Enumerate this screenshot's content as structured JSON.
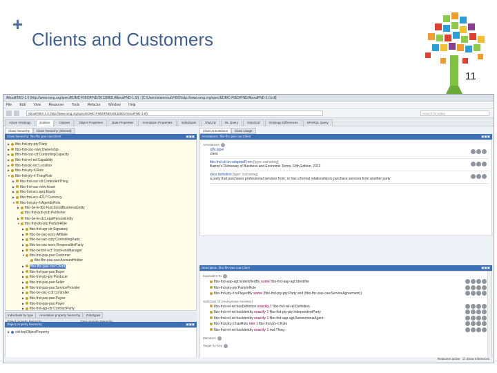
{
  "slide": {
    "plus": "+",
    "title": "Clients and Customers",
    "page_number": "11"
  },
  "app": {
    "window_title": "AboutFIBO-1.0 (http://www.omg.org/spec/EDMC-FIBO/FND/20130801/AboutFND-1.0/) : [C:\\Users\\elanemut\\FIBO\\http://www.omg.org/spec/EDMC-FIBO/FND/AboutFND-1.0.rdf]",
    "menu": [
      "File",
      "Edit",
      "View",
      "Reasoner",
      "Tools",
      "Refactor",
      "Window",
      "Help"
    ],
    "address": "AboutFIBO-1.0 (http://www.omg.org/spec/EDMC-FIBO/FND/20130801/AboutFND-1.0/)",
    "search_placeholder": "Search for entity",
    "tabs": [
      "Active Ontology",
      "Entities",
      "Classes",
      "Object Properties",
      "Data Properties",
      "Annotation Properties",
      "Individuals",
      "OWLViz",
      "DL Query",
      "OntoGraf",
      "Ontology Differences",
      "SPARQL Query"
    ],
    "active_tab": "Entities"
  },
  "left_panel": {
    "subtabs": [
      "Class hierarchy",
      "Class hierarchy (inferred)"
    ],
    "header": "Class hierarchy: fibo-fbc-pas-caa:Client",
    "tree": [
      {
        "label": "fibo-fnd-pty-pty:Party",
        "indent": 0,
        "arrow": "▶"
      },
      {
        "label": "fibo-fnd-oac-own:Ownership",
        "indent": 0,
        "arrow": "▶"
      },
      {
        "label": "fibo-fnd-oac-ctl:ControllingCapacity",
        "indent": 0,
        "arrow": "▶"
      },
      {
        "label": "fibo-fnd-rel-rel:Capability",
        "indent": 0,
        "arrow": "▶"
      },
      {
        "label": "fibo-fnd-plc-loc:Location",
        "indent": 0,
        "arrow": "▶"
      },
      {
        "label": "fibo-fnd-pty-rl:Role",
        "indent": 0,
        "arrow": "▶"
      },
      {
        "label": "fibo-fnd-pty-rl:ThingRole",
        "indent": 0,
        "arrow": "▼"
      },
      {
        "label": "fibo-fnd-oac-ctl:ControlledThing",
        "indent": 1,
        "arrow": "▶"
      },
      {
        "label": "fibo-fnd-oac-own:Asset",
        "indent": 1,
        "arrow": "▶"
      },
      {
        "label": "fibo-fnd-acc-aeq:Equity",
        "indent": 1,
        "arrow": "▶"
      },
      {
        "label": "fibo-fnd-acc-4217:Currency",
        "indent": 1,
        "arrow": "▶"
      },
      {
        "label": "fibo-fnd-pty-rl:AgentInRole",
        "indent": 1,
        "arrow": "▼"
      },
      {
        "label": "fibo-be-le-fbo:FunctionalBusinessEntity",
        "indent": 2,
        "arrow": "▶"
      },
      {
        "label": "fibo-fnd-pub-pub:Publisher",
        "indent": 2,
        "arrow": ""
      },
      {
        "label": "fibo-be-le-cb:LegalPersonEntity",
        "indent": 2,
        "arrow": "▶"
      },
      {
        "label": "fibo-fnd-pty-pty:PartyInRole",
        "indent": 2,
        "arrow": "▼"
      },
      {
        "label": "fibo-fnd-agr-ctr:Signatory",
        "indent": 3,
        "arrow": "▶"
      },
      {
        "label": "fibo-be-oac-exec:Affiliate",
        "indent": 3,
        "arrow": "▶"
      },
      {
        "label": "fibo-be-oac-cpty:ControllingParty",
        "indent": 3,
        "arrow": "▶"
      },
      {
        "label": "fibo-be-oac-exec:ResponsibleParty",
        "indent": 3,
        "arrow": "▶"
      },
      {
        "label": "fibo-be-tmf-ocf:TrustFundManager",
        "indent": 3,
        "arrow": "▶"
      },
      {
        "label": "fibo-fnd-pas-pas:Customer",
        "indent": 3,
        "arrow": "▼"
      },
      {
        "label": "fibo-fbc-pas-caa:AccountHolder",
        "indent": 4,
        "arrow": ""
      },
      {
        "label": "fibo-fbc-pas-caa:Client",
        "indent": 3,
        "arrow": "▶",
        "selected": true
      },
      {
        "label": "fibo-fnd-pas-pas:Buyer",
        "indent": 3,
        "arrow": "▶"
      },
      {
        "label": "fibo-fnd-pty-pty:Producer",
        "indent": 3,
        "arrow": "▶"
      },
      {
        "label": "fibo-fnd-pas-pas:Seller",
        "indent": 3,
        "arrow": "▶"
      },
      {
        "label": "fibo-fnd-pas-pas:ServiceProvider",
        "indent": 3,
        "arrow": "▶"
      },
      {
        "label": "fibo-be-oac-cctl:Controller",
        "indent": 3,
        "arrow": "▶"
      },
      {
        "label": "fibo-fnd-pas-pas:Payee",
        "indent": 3,
        "arrow": "▶"
      },
      {
        "label": "fibo-fnd-pas-pas:Payer",
        "indent": 3,
        "arrow": "▶"
      },
      {
        "label": "fibo-fnd-agr-ctr:ContractParty",
        "indent": 3,
        "arrow": "▶"
      },
      {
        "label": "fibo-fnd-agr-ctr:ContractThirdParty",
        "indent": 3,
        "arrow": "▶"
      }
    ],
    "lower_tabs": [
      "Individuals by type",
      "Annotation property hierarchy",
      "Datatypes"
    ],
    "lower_tabs_row2": [
      "Object property hierarchy",
      "Data property hierarchy"
    ],
    "obj_header": "Object property hierarchy:",
    "obj_root": "owl:topObjectProperty"
  },
  "right_panel": {
    "subtabs": [
      "Class Annotations",
      "Class Usage"
    ],
    "annotations_header": "Annotations: fibo-fbc-pas-caa:Client",
    "annotations_label": "Annotations",
    "annotations": [
      {
        "prop": "rdfs:label",
        "value": "client"
      },
      {
        "prop": "fibo-fnd-utl-av:adaptedFrom",
        "lang": "[type: xsd:string]",
        "value": "Barron's Dictionary of Business and Economic Terms, Fifth Edition, 2012"
      },
      {
        "prop": "skos:definition",
        "lang": "[type: xsd:string]",
        "value": "a party that purchases professional services from, or has a formal relationship to purchase services from another party"
      }
    ],
    "description_header": "Description: fibo-fbc-pas-caa:Client",
    "equivalent_label": "Equivalent To",
    "equivalent": [
      {
        "pre": "fibo-fnd-aap-agt:isIdentifiedBy",
        "kw": "some",
        "post": "fibo-fnd-aap-agt:Identifier"
      },
      {
        "pre": "fibo-fnd-pty-pty:PartyInRole",
        "kw": "",
        "post": ""
      },
      {
        "pre": "fibo-fnd-pty-rl:isPlayedBy",
        "kw": "some",
        "post": "(fibo-fnd-pty-pty:Party and (fibo-fbc-pas-caa:ServiceAgreement))"
      }
    ],
    "subclass_label": "SubClass Of (Anonymous Ancestor)",
    "subclass": [
      {
        "pre": "fibo-fnd-rel-rel:hasDefinition",
        "kw": "exactly",
        "post": "1 fibo-fnd-rel-rel:Definition"
      },
      {
        "pre": "fibo-fnd-rel-rel:hasIdentity",
        "kw": "exactly",
        "post": "1 fibo-fnd-pty-pty:IndependentParty"
      },
      {
        "pre": "fibo-fnd-rel-rel:hasIdentity",
        "kw": "exactly",
        "post": "1 fibo-fnd-aap-agt:AutonomousAgent"
      },
      {
        "pre": "fibo-fnd-pty-rl:hasRole",
        "kw": "min",
        "post": "1 fibo-fnd-pty-rl:Role"
      },
      {
        "pre": "fibo-fnd-rel-rel:hasIdentity",
        "kw": "exactly",
        "post": "1 owl:Thing"
      }
    ],
    "members_label": "Members",
    "target_label": "Target for Key",
    "status_text": "Reasoner active",
    "status_check": "Show Inferences"
  }
}
